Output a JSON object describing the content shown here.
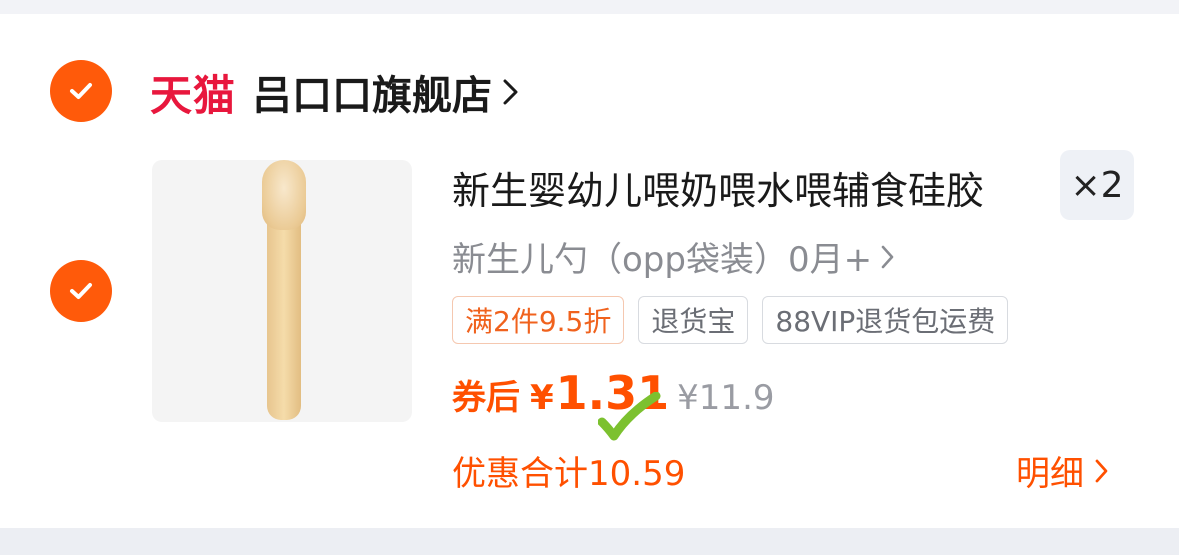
{
  "store": {
    "platform": "天猫",
    "name": "吕口口旗舰店",
    "checked": true
  },
  "item": {
    "checked": true,
    "title": "新生婴幼儿喂奶喂水喂辅食硅胶",
    "quantity": "×2",
    "sku": "新生儿勺（opp袋装）0月+",
    "tags": [
      "满2件9.5折",
      "退货宝",
      "88VIP退货包运费"
    ],
    "price_label": "券后",
    "price_currency": "¥",
    "price_value": "1.31",
    "original_price": "¥11.9",
    "discount_total": "优惠合计10.59",
    "detail_link": "明细"
  },
  "colors": {
    "accent": "#ff5000",
    "check": "#ff5a0a",
    "tmall": "#e8173d",
    "overlay_tick": "#7cc12f"
  },
  "icons": [
    "check-icon",
    "chevron-right-icon"
  ]
}
